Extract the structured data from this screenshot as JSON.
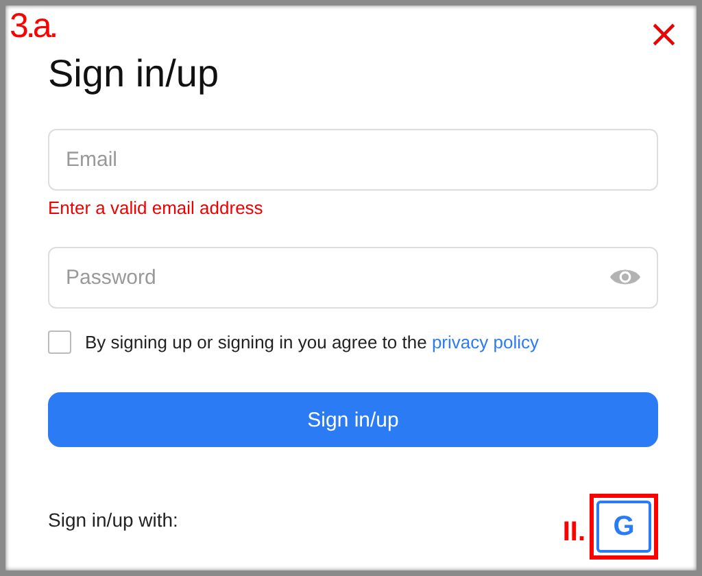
{
  "step_label": "3.a.",
  "close_button": {
    "symbol": "×"
  },
  "title": "Sign in/up",
  "email": {
    "placeholder": "Email",
    "error": "Enter a valid email address"
  },
  "password": {
    "placeholder": "Password"
  },
  "consent": {
    "checked": false,
    "text": "By signing up or signing in you agree to the ",
    "link": "privacy policy"
  },
  "submit_button": "Sign in/up",
  "social": {
    "label": "Sign in/up with:",
    "marker": "II.",
    "highlighted": true,
    "google_button": "G"
  }
}
